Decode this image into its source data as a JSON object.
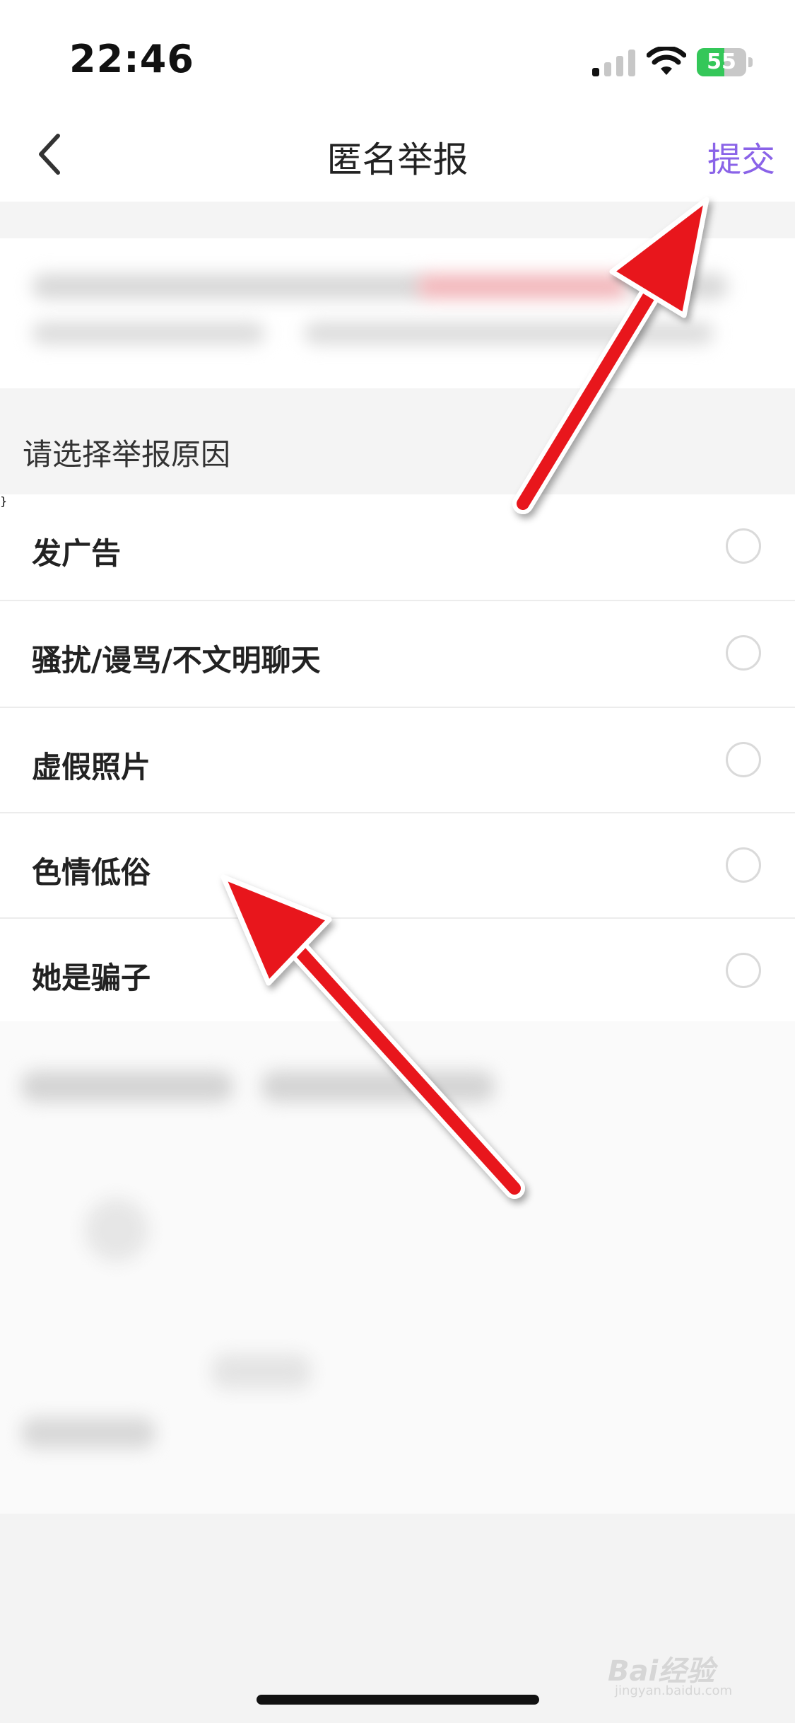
{
  "status_bar": {
    "time": "22:46",
    "battery_level": "55",
    "battery_fraction": 0.55
  },
  "nav": {
    "title": "匿名举报",
    "submit_label": "提交"
  },
  "section": {
    "prompt": "请选择举报原因"
  },
  "options": [
    {
      "label": "发广告",
      "selected": false
    },
    {
      "label": "骚扰/谩骂/不文明聊天",
      "selected": false
    },
    {
      "label": "虚假照片",
      "selected": false
    },
    {
      "label": "色情低俗",
      "selected": false
    },
    {
      "label": "她是骗子",
      "selected": false
    }
  ],
  "watermark": {
    "brand": "Bai经验",
    "url": "jingyan.baidu.com"
  },
  "colors": {
    "accent": "#8a63e8",
    "annotation_arrow": "#e8141b",
    "battery": "#34c759"
  }
}
